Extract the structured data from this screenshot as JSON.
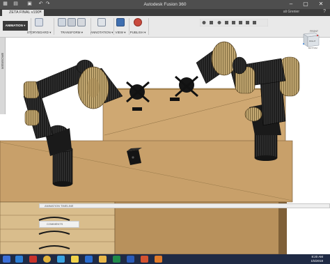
{
  "window": {
    "title": "Autodesk Fusion 360"
  },
  "document_tab": {
    "name": "ZETA FINAL v190*"
  },
  "user": {
    "name": "ali Grenier"
  },
  "help": {
    "label": "?"
  },
  "workspace": {
    "label": "ANIMATION ▾"
  },
  "ribbon": {
    "groups": [
      {
        "label": "STORYBOARD ▾"
      },
      {
        "label": "TRANSFORM ▾"
      },
      {
        "label": "ANNOTATION ▾"
      },
      {
        "label": "VIEW ▾"
      },
      {
        "label": "PUBLISH ▾"
      }
    ]
  },
  "browser": {
    "label": "BROWSER"
  },
  "viewcube": {
    "top_label": "FRONT",
    "side_label": "RIGHT",
    "face_label": "BOTTOM"
  },
  "timeline": {
    "label": "ANIMATION TIMELINE"
  },
  "comments": {
    "label": "COMMENTS"
  },
  "taskbar": {
    "time": "8:20 AM",
    "date": "1/5/2018",
    "icons": [
      "windows-start-icon",
      "file-explorer-icon",
      "acrobat-icon",
      "chrome-icon",
      "people-icon",
      "sticky-notes-icon",
      "mail-icon",
      "folder-icon",
      "excel-icon",
      "word-icon",
      "powerpoint-icon",
      "fusion-icon"
    ]
  },
  "colors": {
    "title_bar": "#4e4e4e",
    "ribbon": "#e9e9e9",
    "table_wood": "#c9a46c",
    "robot_segment": "#1c1c1c",
    "robot_joint": "#bfa46c",
    "taskbar": "#1f2a44"
  }
}
